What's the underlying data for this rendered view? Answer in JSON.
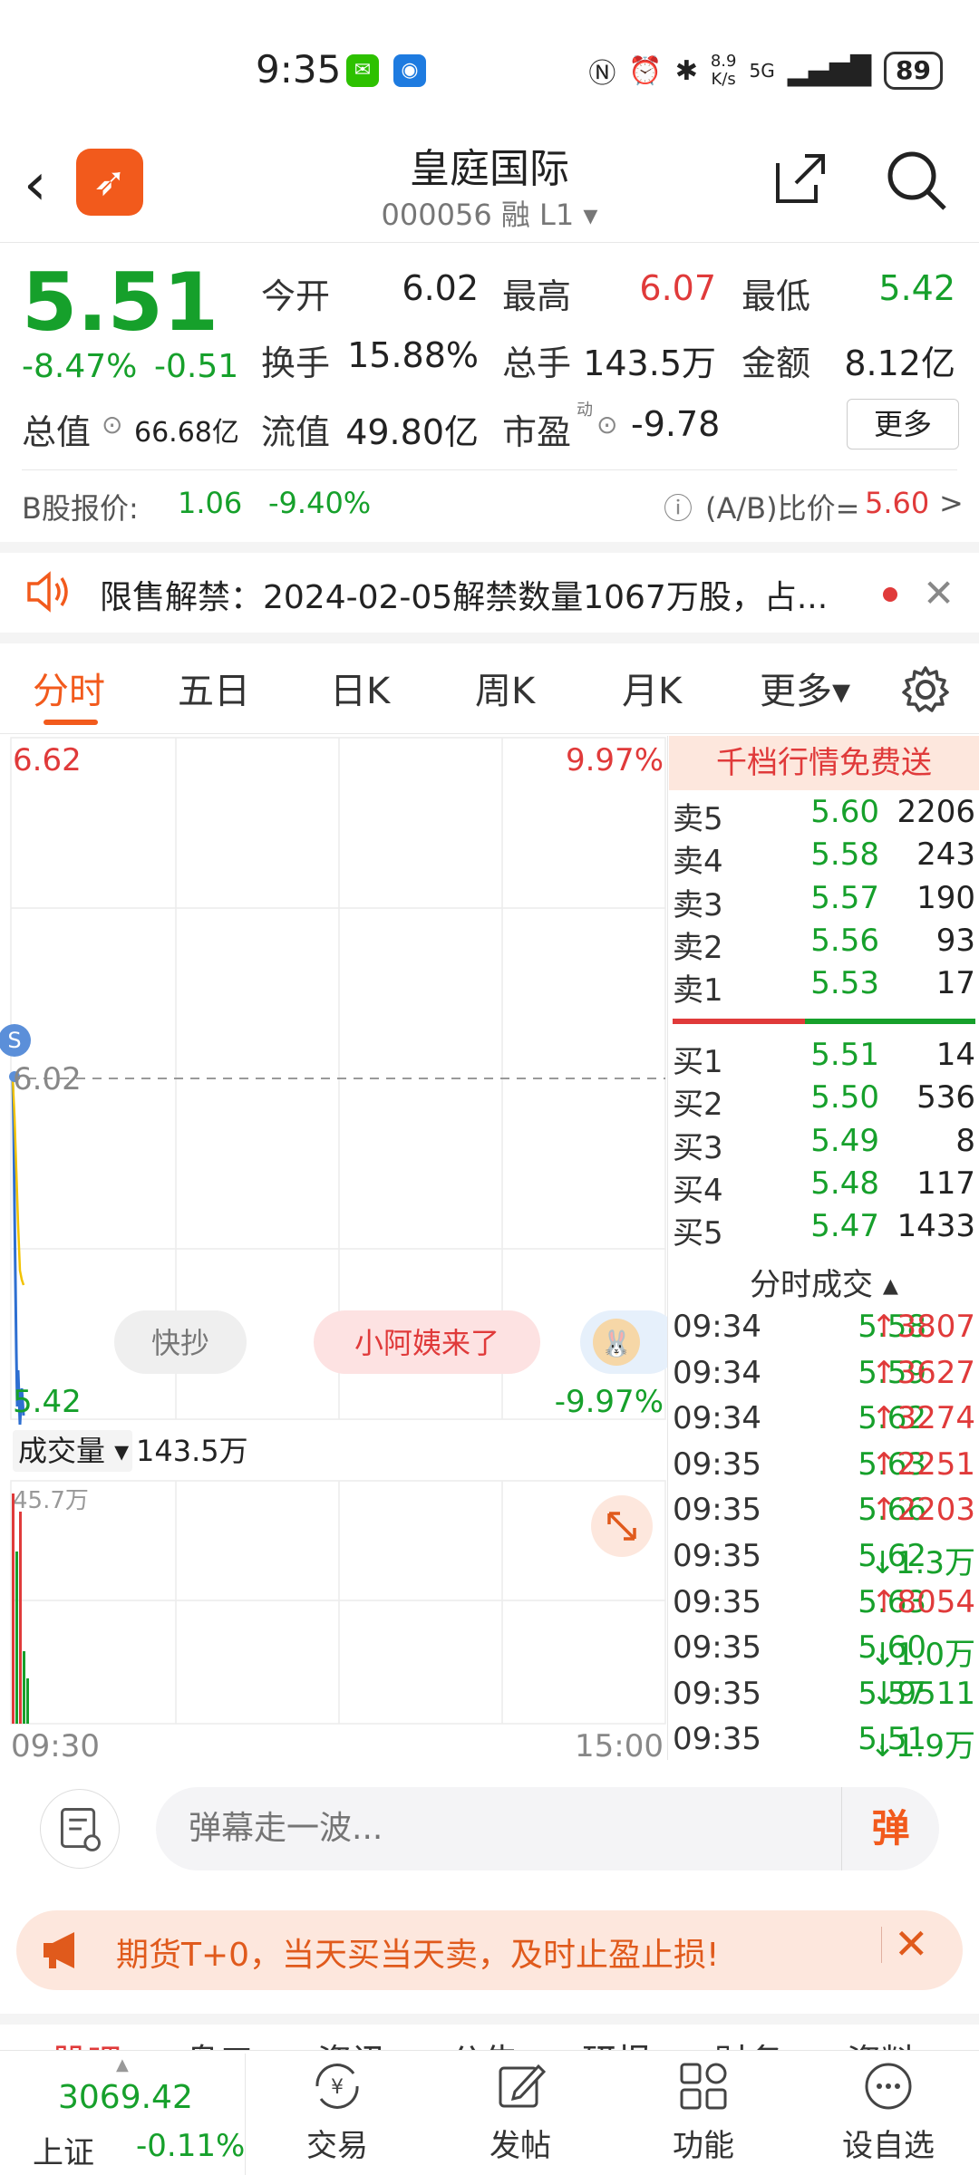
{
  "status_bar": {
    "time": "9:35",
    "net_speed_top": "8.9",
    "net_speed_bottom": "K/s",
    "signal": "5G",
    "battery": "89"
  },
  "header": {
    "back_glyph": "‹",
    "title": "皇庭国际",
    "code": "000056 融 L1 ▾"
  },
  "quote": {
    "price": "5.51",
    "change_pct": "-8.47%",
    "change_val": "-0.51",
    "open_label": "今开",
    "open": "6.02",
    "high_label": "最高",
    "high": "6.07",
    "low_label": "最低",
    "low": "5.42",
    "turnover_label": "换手",
    "turnover": "15.88%",
    "volume_label": "总手",
    "volume": "143.5万",
    "amount_label": "金额",
    "amount": "8.12亿",
    "mktcap_label": "总值",
    "mktcap": "66.68亿",
    "float_label": "流值",
    "float": "49.80亿",
    "pe_label": "市盈",
    "pe_sup": "动",
    "pe": "-9.78",
    "more_button": "更多"
  },
  "bshare": {
    "label": "B股报价:",
    "price": "1.06",
    "change": "-9.40%",
    "ratio_label": "(A/B)比价=",
    "ratio": "5.60",
    "arrow": ">"
  },
  "notice": {
    "text": "限售解禁：2024-02-05解禁数量1067万股，占..."
  },
  "tabs": [
    {
      "label": "分时",
      "active": true
    },
    {
      "label": "五日"
    },
    {
      "label": "日K"
    },
    {
      "label": "周K"
    },
    {
      "label": "月K"
    },
    {
      "label": "更多▾"
    }
  ],
  "chart": {
    "top_price": "6.62",
    "top_pct": "9.97%",
    "ref_price": "6.02",
    "bottom_price": "5.42",
    "bottom_pct": "-9.97%",
    "marker": "S",
    "chip1": "快抄",
    "chip2": "小阿姨来了",
    "vol_label": "成交量 ▾",
    "vol_value": "143.5万",
    "vol_max": "45.7万",
    "time_start": "09:30",
    "time_end": "15:00"
  },
  "orderbook": {
    "header": "千档行情免费送",
    "asks": [
      {
        "label": "卖5",
        "price": "5.60",
        "vol": "2206"
      },
      {
        "label": "卖4",
        "price": "5.58",
        "vol": "243"
      },
      {
        "label": "卖3",
        "price": "5.57",
        "vol": "190"
      },
      {
        "label": "卖2",
        "price": "5.56",
        "vol": "93"
      },
      {
        "label": "卖1",
        "price": "5.53",
        "vol": "17"
      }
    ],
    "bids": [
      {
        "label": "买1",
        "price": "5.51",
        "vol": "14"
      },
      {
        "label": "买2",
        "price": "5.50",
        "vol": "536"
      },
      {
        "label": "买3",
        "price": "5.49",
        "vol": "8"
      },
      {
        "label": "买4",
        "price": "5.48",
        "vol": "117"
      },
      {
        "label": "买5",
        "price": "5.47",
        "vol": "1433"
      }
    ]
  },
  "ticks": {
    "header": "分时成交 ▴",
    "rows": [
      {
        "time": "09:34",
        "price": "5.58",
        "vol": "↑3807",
        "up": true
      },
      {
        "time": "09:34",
        "price": "5.59",
        "vol": "↑3627",
        "up": true
      },
      {
        "time": "09:34",
        "price": "5.62",
        "vol": "↑3274",
        "up": true
      },
      {
        "time": "09:35",
        "price": "5.63",
        "vol": "↑2251",
        "up": true
      },
      {
        "time": "09:35",
        "price": "5.66",
        "vol": "↑2203",
        "up": true
      },
      {
        "time": "09:35",
        "price": "5.62",
        "vol": "↓1.3万",
        "up": false
      },
      {
        "time": "09:35",
        "price": "5.63",
        "vol": "↑8054",
        "up": true
      },
      {
        "time": "09:35",
        "price": "5.60",
        "vol": "↓1.0万",
        "up": false
      },
      {
        "time": "09:35",
        "price": "5.57",
        "vol": "↓9511",
        "up": false
      },
      {
        "time": "09:35",
        "price": "5.51",
        "vol": "↓1.9万",
        "up": false
      }
    ]
  },
  "comment": {
    "placeholder": "弹幕走一波...",
    "send": "弹"
  },
  "promo": {
    "text": "期货T+0，当天买当天卖，及时止盈止损!",
    "close": "✕"
  },
  "subtabs": [
    "股吧",
    "盘口",
    "资讯",
    "公告",
    "研报",
    "财务",
    "资料"
  ],
  "bottom_nav": {
    "index_value": "3069.42",
    "index_name": "上证",
    "index_change": "-0.11%",
    "items": [
      "交易",
      "发帖",
      "功能",
      "设自选"
    ]
  },
  "colors": {
    "up": "#e03a3a",
    "down": "#16a02b",
    "accent": "#f25a1c"
  }
}
